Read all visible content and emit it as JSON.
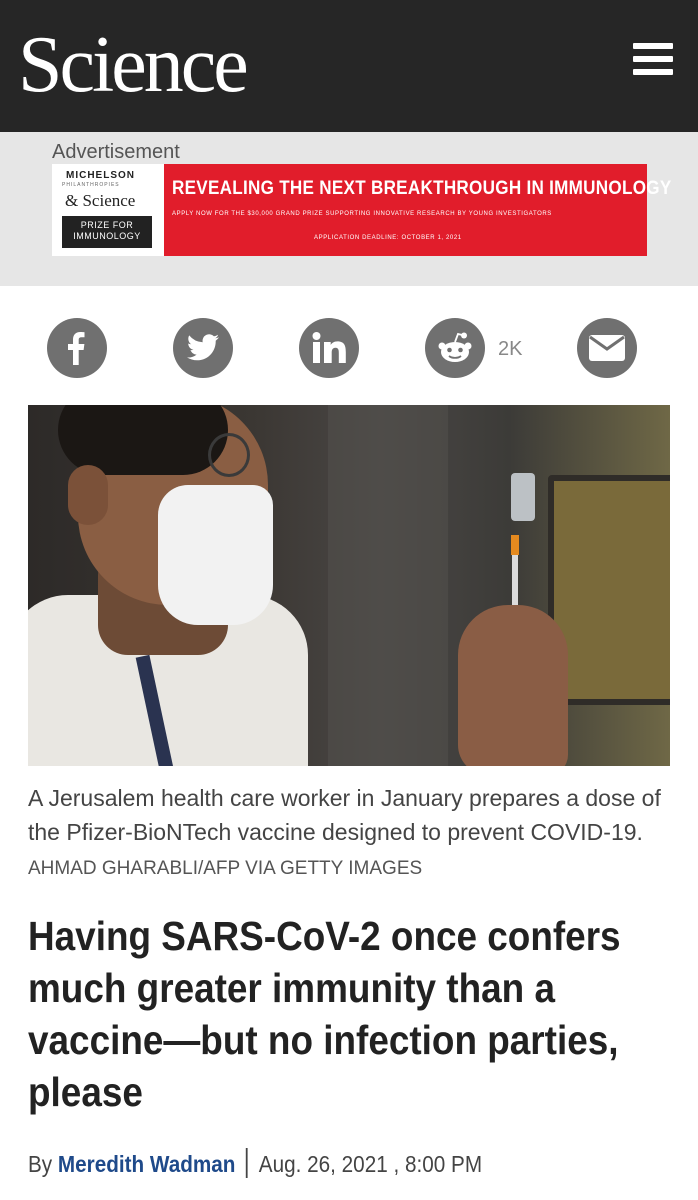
{
  "header": {
    "logo": "Science",
    "menu_icon": "hamburger-menu-icon"
  },
  "ad": {
    "label": "Advertisement",
    "logo_line1": "MICHELSON",
    "logo_line2": "PHILANTHROPIES",
    "logo_line3": "& Science",
    "prize_text": "PRIZE FOR IMMUNOLOGY",
    "headline": "REVEALING THE NEXT BREAKTHROUGH IN IMMUNOLOGY",
    "subline": "APPLY NOW FOR THE $30,000 GRAND PRIZE SUPPORTING INNOVATIVE RESEARCH BY YOUNG INVESTIGATORS",
    "deadline": "APPLICATION DEADLINE: OCTOBER 1, 2021",
    "brand_color": "#e11d2b"
  },
  "share": {
    "icons": [
      "facebook-icon",
      "twitter-icon",
      "linkedin-icon",
      "reddit-icon",
      "email-icon"
    ],
    "reddit_count": "2K",
    "button_color": "#707070"
  },
  "article": {
    "caption": "A Jerusalem health care worker in January prepares a dose of the Pfizer-BioNTech vaccine designed to prevent COVID-19.",
    "credit": "AHMAD GHARABLI/AFP VIA GETTY IMAGES",
    "headline": "Having SARS-CoV-2 once confers much greater immunity than a vaccine—but no infection parties, please",
    "byline_prefix": "By",
    "author": "Meredith Wadman",
    "date": "Aug. 26, 2021 , 8:00 PM",
    "author_color": "#1f4a8a"
  }
}
